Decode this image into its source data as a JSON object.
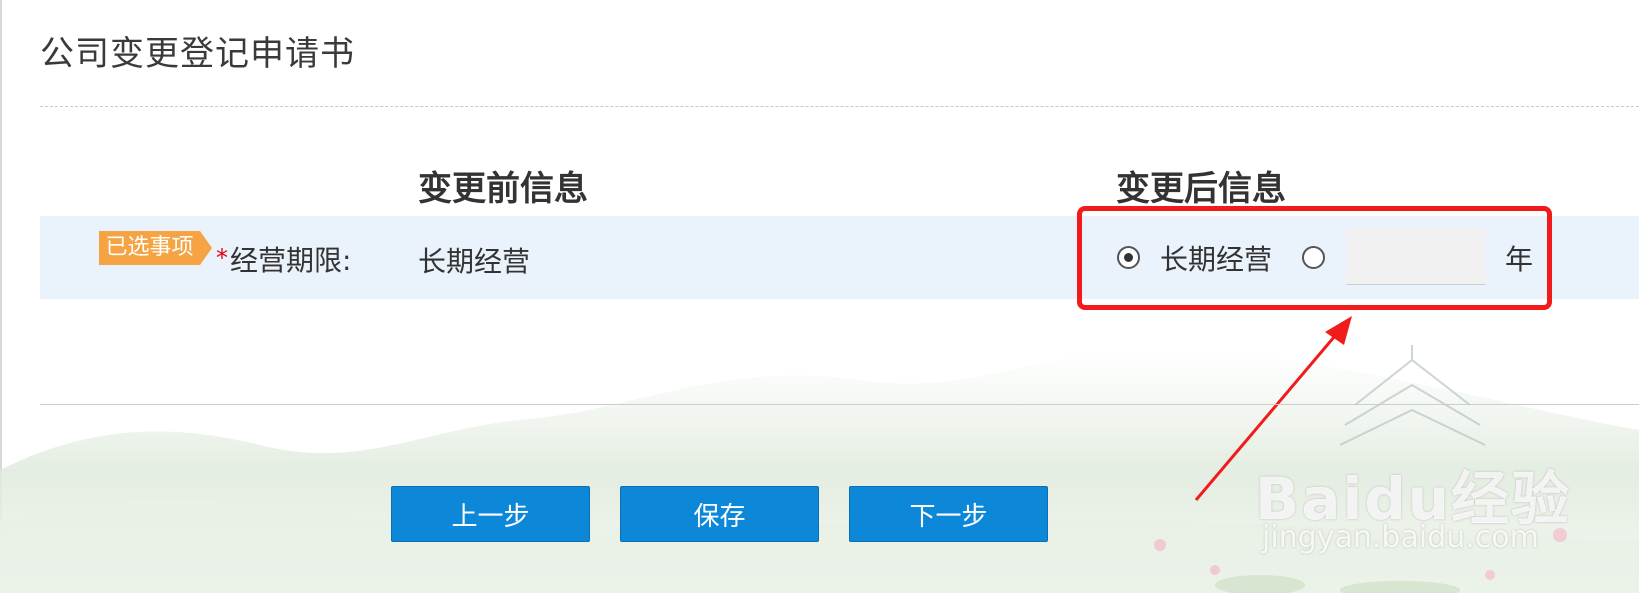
{
  "page": {
    "title": "公司变更登记申请书"
  },
  "columns": {
    "before": "变更前信息",
    "after": "变更后信息"
  },
  "row": {
    "tag": "已选事项",
    "required_mark": "*",
    "label": "经营期限:",
    "before_value": "长期经营",
    "options": {
      "long_term": {
        "label": "长期经营",
        "selected": true
      },
      "years": {
        "selected": false,
        "value": "",
        "unit": "年"
      }
    }
  },
  "buttons": {
    "prev": "上一步",
    "save": "保存",
    "next": "下一步"
  },
  "watermark": {
    "brand": "Baidu经验",
    "url": "jingyan.baidu.com"
  },
  "colors": {
    "accent_button": "#0d88d8",
    "tag": "#f5a343",
    "highlight": "#f21b1b",
    "row_band": "#eaf2fc"
  }
}
